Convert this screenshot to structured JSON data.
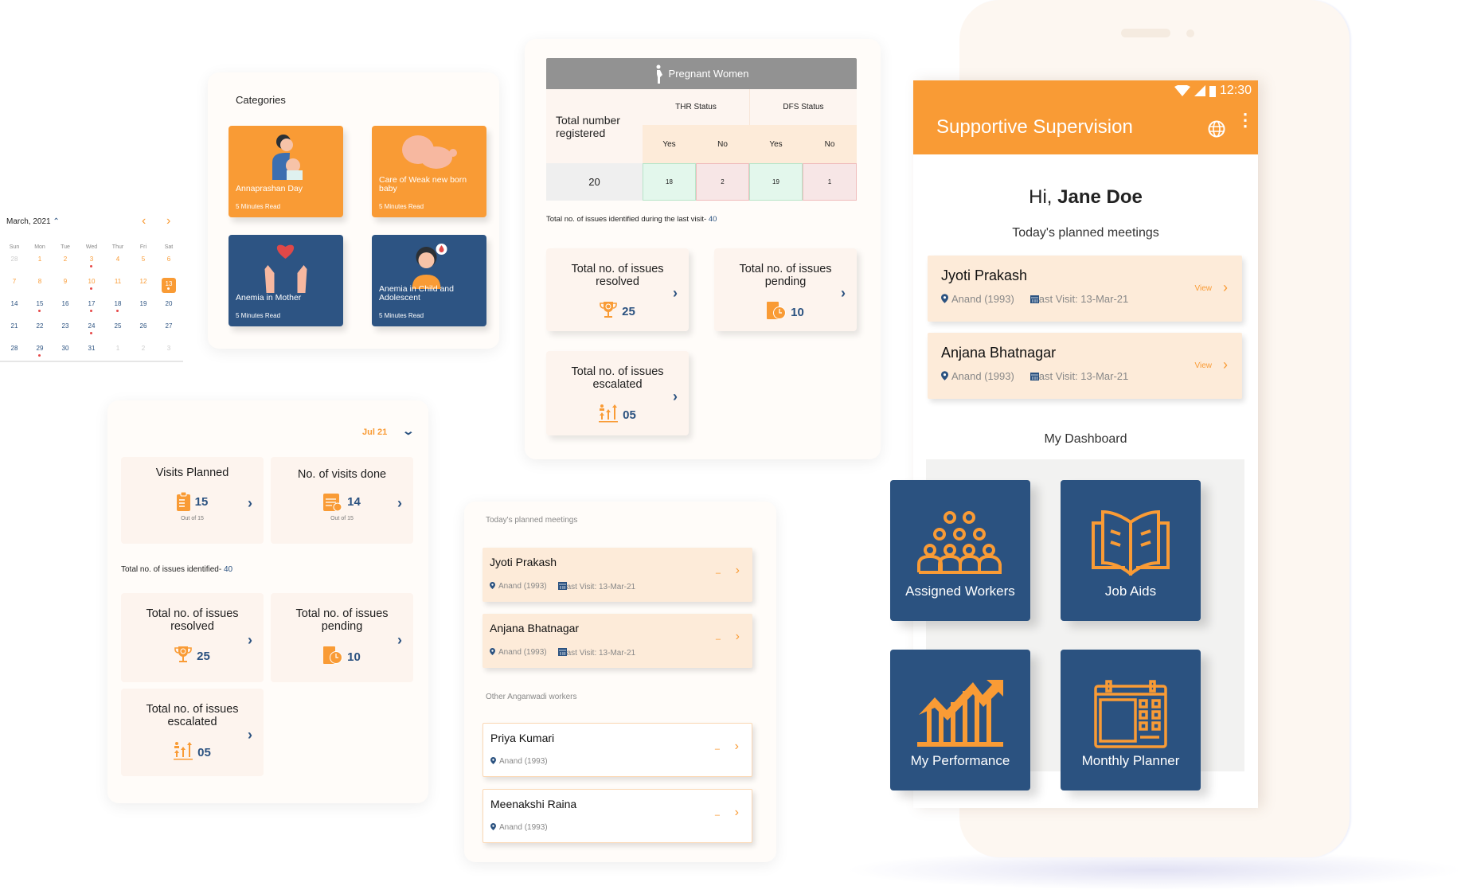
{
  "colors": {
    "accent": "#F99B35",
    "primary": "#2B5280",
    "panel": "#FFFCF9",
    "card": "#FDF4EE",
    "meeting_card": "#FDEBD9",
    "yes_cell": "#E3F7EC",
    "no_cell": "#F7E6E6"
  },
  "calendar": {
    "month_label": "March, 2021",
    "weekdays": [
      "Sun",
      "Mon",
      "Tue",
      "Wed",
      "Thur",
      "Fri",
      "Sat"
    ],
    "weeks": [
      [
        "28",
        "1",
        "2",
        "3",
        "4",
        "5",
        "6"
      ],
      [
        "7",
        "8",
        "9",
        "10",
        "11",
        "12",
        "13"
      ],
      [
        "14",
        "15",
        "16",
        "17",
        "18",
        "19",
        "20"
      ],
      [
        "21",
        "22",
        "23",
        "24",
        "25",
        "26",
        "27"
      ],
      [
        "28",
        "29",
        "30",
        "31",
        "1",
        "2",
        "3"
      ]
    ],
    "selected_date": "13",
    "dates_with_events": [
      "3",
      "10",
      "13",
      "15",
      "17",
      "18",
      "24",
      "29"
    ]
  },
  "categories": {
    "title": "Categories",
    "items": [
      {
        "title": "Annaprashan Day",
        "read_time": "5 Minutes Read",
        "color": "#F99B35",
        "icon": "mother-baby-icon"
      },
      {
        "title": "Care of Weak new born baby",
        "read_time": "5 Minutes Read",
        "color": "#F99B35",
        "icon": "newborn-icon"
      },
      {
        "title": "Anemia in Mother",
        "read_time": "5 Minutes Read",
        "color": "#2D5483",
        "icon": "heart-hands-icon"
      },
      {
        "title": "Anemia in Child and Adolescent",
        "read_time": "5 Minutes Read",
        "color": "#2D5483",
        "icon": "child-blood-icon"
      }
    ]
  },
  "pregnant_women": {
    "title": "Pregnant Women",
    "total_label": "Total number registered",
    "thr_label": "THR Status",
    "dfs_label": "DFS Status",
    "yes": "Yes",
    "no": "No",
    "total": "20",
    "thr_yes": "18",
    "thr_no": "2",
    "dfs_yes": "19",
    "dfs_no": "1",
    "issues_text": "Total no. of issues identified during the last visit- ",
    "issues_count": "40",
    "cards": [
      {
        "label": "Total no. of issues resolved",
        "value": "25",
        "icon": "trophy-icon"
      },
      {
        "label": "Total no. of issues pending",
        "value": "10",
        "icon": "pending-clock-icon"
      },
      {
        "label": "Total no. of issues escalated",
        "value": "05",
        "icon": "escalate-icon"
      }
    ]
  },
  "visits": {
    "month": "Jul 21",
    "planned": {
      "label": "Visits Planned",
      "value": "15",
      "sub": "Out of 15"
    },
    "done": {
      "label": "No. of visits done",
      "value": "14",
      "sub": "Out of 15"
    },
    "issues_text": "Total no. of issues identified- ",
    "issues_count": "40",
    "cards": [
      {
        "label": "Total no. of issues resolved",
        "value": "25",
        "icon": "trophy-icon"
      },
      {
        "label": "Total no. of issues pending",
        "value": "10",
        "icon": "pending-clock-icon"
      },
      {
        "label": "Total no. of issues escalated",
        "value": "05",
        "icon": "escalate-icon"
      }
    ]
  },
  "meetings_panel": {
    "planned_title": "Today's planned meetings",
    "planned": [
      {
        "name": "Jyoti Prakash",
        "location": "Anand (1993)",
        "last_visit": "ast Visit: 13-Mar-21",
        "dash": "–"
      },
      {
        "name": "Anjana Bhatnagar",
        "location": "Anand (1993)",
        "last_visit": "ast Visit: 13-Mar-21",
        "dash": "–"
      }
    ],
    "other_title": "Other Anganwadi workers",
    "other": [
      {
        "name": "Priya Kumari",
        "location": "Anand (1993)",
        "dash": "–"
      },
      {
        "name": "Meenakshi Raina",
        "location": "Anand (1993)",
        "dash": "–"
      }
    ]
  },
  "phone": {
    "time": "12:30",
    "app_title": "Supportive Supervision",
    "greeting": "Hi, ",
    "user_name": "Jane Doe",
    "meetings_title": "Today's planned meetings",
    "meetings": [
      {
        "name": "Jyoti Prakash",
        "location": "Anand (1993)",
        "last_visit": "ast Visit: 13-Mar-21",
        "view": "View"
      },
      {
        "name": "Anjana Bhatnagar",
        "location": "Anand (1993)",
        "last_visit": "ast Visit: 13-Mar-21",
        "view": "View"
      }
    ],
    "dashboard_title": "My Dashboard",
    "dashboard": [
      {
        "label": "Assigned Workers",
        "icon": "group-people-icon"
      },
      {
        "label": "Job Aids",
        "icon": "open-book-icon"
      },
      {
        "label": "My Performance",
        "icon": "growth-chart-icon"
      },
      {
        "label": "Monthly Planner",
        "icon": "calendar-planner-icon"
      }
    ]
  }
}
